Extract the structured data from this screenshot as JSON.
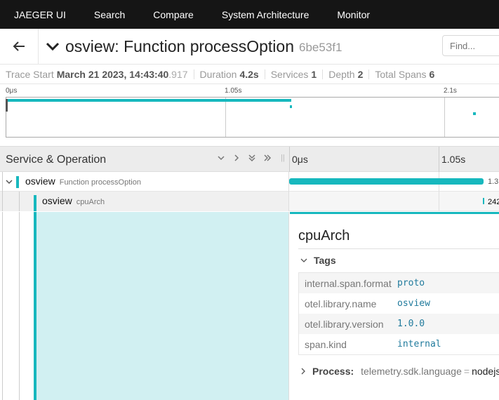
{
  "nav": {
    "brand": "JAEGER UI",
    "links": [
      "Search",
      "Compare",
      "System Architecture",
      "Monitor"
    ]
  },
  "header": {
    "title": "osview: Function processOption",
    "trace_id": "6be53f1",
    "find_placeholder": "Find..."
  },
  "summary": {
    "trace_start_label": "Trace Start",
    "trace_start_value": "March 21 2023, 14:43:40",
    "trace_start_ms": ".917",
    "duration_label": "Duration",
    "duration_value": "4.2s",
    "services_label": "Services",
    "services_value": "1",
    "depth_label": "Depth",
    "depth_value": "2",
    "total_spans_label": "Total Spans",
    "total_spans_value": "6"
  },
  "minimap": {
    "ticks": [
      "0μs",
      "1.05s",
      "2.1s"
    ]
  },
  "table": {
    "service_operation_label": "Service & Operation",
    "timeline_ticks": [
      "0μs",
      "1.05s"
    ]
  },
  "spans": [
    {
      "service": "osview",
      "operation": "Function processOption",
      "duration_label": "1.3"
    },
    {
      "service": "osview",
      "operation": "cpuArch",
      "duration_label": "242"
    }
  ],
  "detail": {
    "title": "cpuArch",
    "tags_label": "Tags",
    "tags": [
      {
        "key": "internal.span.format",
        "value": "proto"
      },
      {
        "key": "otel.library.name",
        "value": "osview"
      },
      {
        "key": "otel.library.version",
        "value": "1.0.0"
      },
      {
        "key": "span.kind",
        "value": "internal"
      }
    ],
    "process_label": "Process:",
    "process_key": "telemetry.sdk.language",
    "process_value": "nodejs"
  },
  "colors": {
    "accent": "#17b8be",
    "topnav_bg": "#151515",
    "detail_bg": "#d1f0f2"
  },
  "icons": [
    "back-arrow-icon",
    "chevron-down-icon",
    "chevron-right-icon",
    "collapse-all-icon",
    "expand-all-icon"
  ]
}
